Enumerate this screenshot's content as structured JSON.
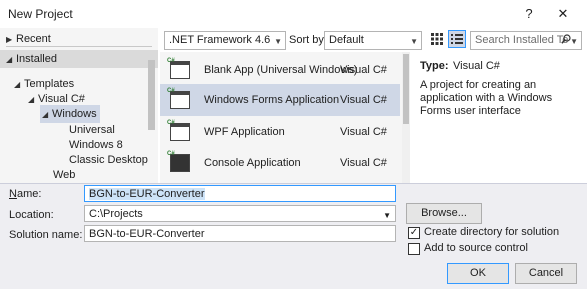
{
  "window": {
    "title": "New Project",
    "help_glyph": "?",
    "close_glyph": "✕"
  },
  "sidebar": {
    "recent": "Recent",
    "installed": "Installed",
    "templates": "Templates",
    "visual_csharp": "Visual C#",
    "windows": "Windows",
    "universal": "Universal",
    "windows8": "Windows 8",
    "classic_desktop": "Classic Desktop",
    "web": "Web"
  },
  "filter": {
    "framework": ".NET Framework 4.6",
    "sort_label": "Sort by:",
    "sort_value": "Default",
    "search_placeholder": "Search Installed Te"
  },
  "templates": [
    {
      "name": "Blank App (Universal Windows)",
      "lang": "Visual C#"
    },
    {
      "name": "Windows Forms Application",
      "lang": "Visual C#"
    },
    {
      "name": "WPF Application",
      "lang": "Visual C#"
    },
    {
      "name": "Console Application",
      "lang": "Visual C#"
    }
  ],
  "details": {
    "type_label": "Type:",
    "type_value": "Visual C#",
    "description": "A project for creating an application with a  Windows Forms user interface"
  },
  "form": {
    "name_label": "Name:",
    "name_value": "BGN-to-EUR-Converter",
    "location_label": "Location:",
    "location_value": "C:\\Projects",
    "solution_label": "Solution name:",
    "solution_value": "BGN-to-EUR-Converter",
    "browse_label": "Browse...",
    "create_dir_label": "Create directory for solution",
    "create_dir_checked": true,
    "source_control_label": "Add to source control",
    "source_control_checked": false,
    "ok_label": "OK",
    "cancel_label": "Cancel"
  }
}
